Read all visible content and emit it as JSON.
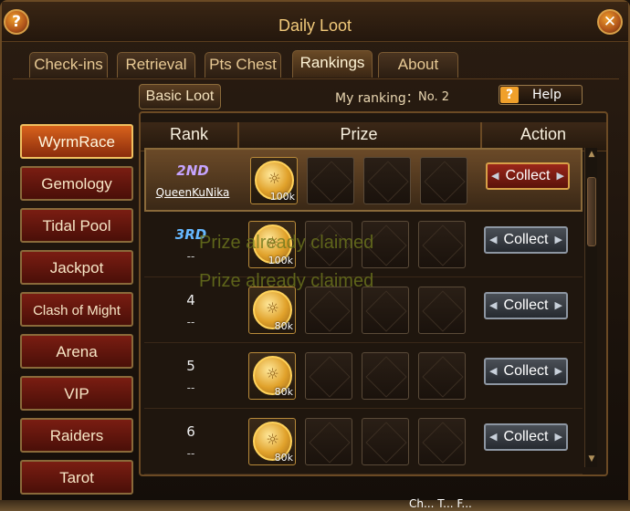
{
  "window": {
    "title": "Daily Loot"
  },
  "corner_buttons": {
    "help_glyph": "?",
    "close_glyph": "✕"
  },
  "tabs": [
    {
      "label": "Check-ins",
      "active": false
    },
    {
      "label": "Retrieval",
      "active": false
    },
    {
      "label": "Pts Chest",
      "active": false
    },
    {
      "label": "Rankings",
      "active": true
    },
    {
      "label": "About",
      "active": false
    }
  ],
  "subtab": {
    "label": "Basic Loot"
  },
  "my_ranking": {
    "label": "My ranking：",
    "value": "No. 2"
  },
  "help": {
    "icon": "?",
    "label": "Help"
  },
  "sidebar": [
    {
      "label": "WyrmRace",
      "active": true
    },
    {
      "label": "Gemology",
      "active": false
    },
    {
      "label": "Tidal Pool",
      "active": false
    },
    {
      "label": "Jackpot",
      "active": false
    },
    {
      "label": "Clash of Might",
      "active": false
    },
    {
      "label": "Arena",
      "active": false
    },
    {
      "label": "VIP",
      "active": false
    },
    {
      "label": "Raiders",
      "active": false
    },
    {
      "label": "Tarot",
      "active": false
    }
  ],
  "table": {
    "headers": {
      "rank": "Rank",
      "prize": "Prize",
      "action": "Action"
    },
    "rows": [
      {
        "rank": "2ND",
        "name": "QueenKuNika",
        "prize_amount": "100k",
        "action": "Collect"
      },
      {
        "rank": "3RD",
        "name": "--",
        "prize_amount": "100k",
        "action": "Collect"
      },
      {
        "rank": "4",
        "name": "--",
        "prize_amount": "80k",
        "action": "Collect"
      },
      {
        "rank": "5",
        "name": "--",
        "prize_amount": "80k",
        "action": "Collect"
      },
      {
        "rank": "6",
        "name": "--",
        "prize_amount": "80k",
        "action": "Collect"
      }
    ]
  },
  "claimed_messages": [
    "Prize already claimed",
    "Prize already claimed"
  ],
  "bottom": {
    "text": "Ch... T... F..."
  },
  "colors": {
    "gold": "#f1c97a",
    "active_tab": "#fff4d6",
    "collect_red": "#9a261a",
    "collect_grey": "#4a4f56",
    "coin": "#e0a12a"
  },
  "icons": {
    "coin": "gold-coin-icon",
    "help": "question-icon",
    "close": "close-icon"
  }
}
